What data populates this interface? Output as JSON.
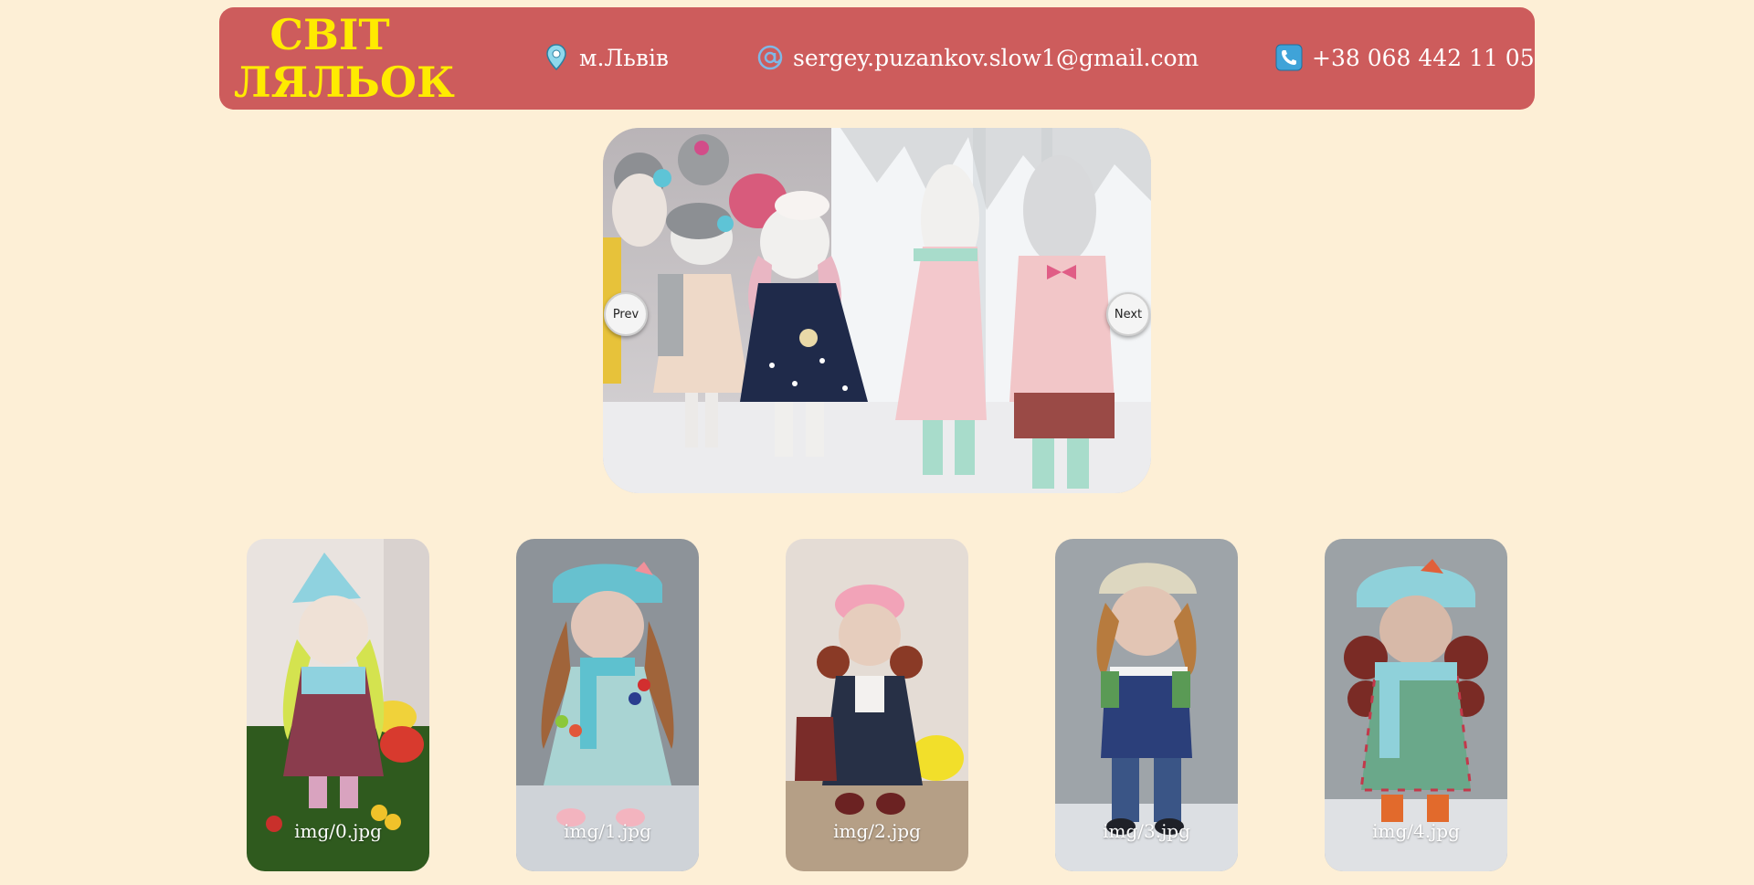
{
  "header": {
    "logo_line1": "СВІТ",
    "logo_line2": "ЛЯЛЬОК",
    "city": "м.Львів",
    "email": "sergey.puzankov.slow1@gmail.com",
    "phone": "+38 068 442 11 05"
  },
  "slider": {
    "prev_label": "Prev",
    "next_label": "Next"
  },
  "gallery": {
    "items": [
      {
        "label": "img/0.jpg"
      },
      {
        "label": "img/1.jpg"
      },
      {
        "label": "img/2.jpg"
      },
      {
        "label": "img/3.jpg"
      },
      {
        "label": "img/4.jpg"
      }
    ]
  },
  "icons": {
    "location": "location-pin-icon",
    "email": "at-sign-icon",
    "phone": "phone-icon"
  },
  "colors": {
    "page_bg": "#fdefd6",
    "header_bg": "#cd5c5c",
    "logo": "#ffeb00",
    "header_text": "#ffffff"
  }
}
